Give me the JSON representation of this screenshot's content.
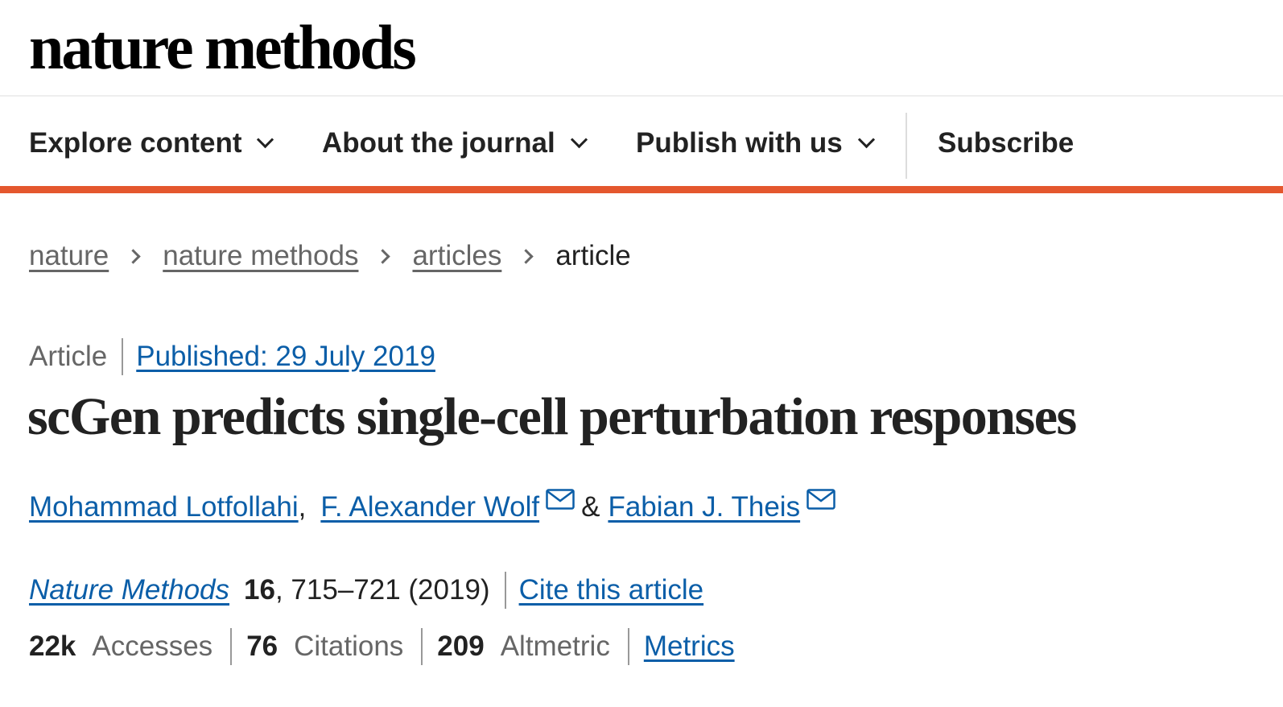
{
  "logo": {
    "text": "nature methods"
  },
  "nav": {
    "items": [
      {
        "label": "Explore content"
      },
      {
        "label": "About the journal"
      },
      {
        "label": "Publish with us"
      }
    ],
    "subscribe_label": "Subscribe",
    "accent_color": "#e4572e"
  },
  "breadcrumb": {
    "items": [
      {
        "label": "nature"
      },
      {
        "label": "nature methods"
      },
      {
        "label": "articles"
      }
    ],
    "current": "article"
  },
  "article": {
    "type": "Article",
    "published": "Published: 29 July 2019",
    "title": "scGen predicts single-cell perturbation responses",
    "authors": [
      {
        "name": "Mohammad Lotfollahi",
        "has_email": false
      },
      {
        "name": "F. Alexander Wolf",
        "has_email": true
      },
      {
        "name": "Fabian J. Theis",
        "has_email": true
      }
    ],
    "author_sep_comma": ",",
    "author_sep_and": "&",
    "journal": "Nature Methods",
    "volume": "16",
    "pages_year": ", 715–721 (2019)",
    "cite_label": "Cite this article",
    "link_color": "#0b5ea8"
  },
  "metrics": {
    "accesses_value": "22k",
    "accesses_label": "Accesses",
    "citations_value": "76",
    "citations_label": "Citations",
    "altmetric_value": "209",
    "altmetric_label": "Altmetric",
    "metrics_link": "Metrics"
  },
  "icons": {
    "nav_chevron": "chevron-down-icon",
    "breadcrumb_sep": "chevron-right-icon",
    "author_email": "envelope-icon"
  }
}
